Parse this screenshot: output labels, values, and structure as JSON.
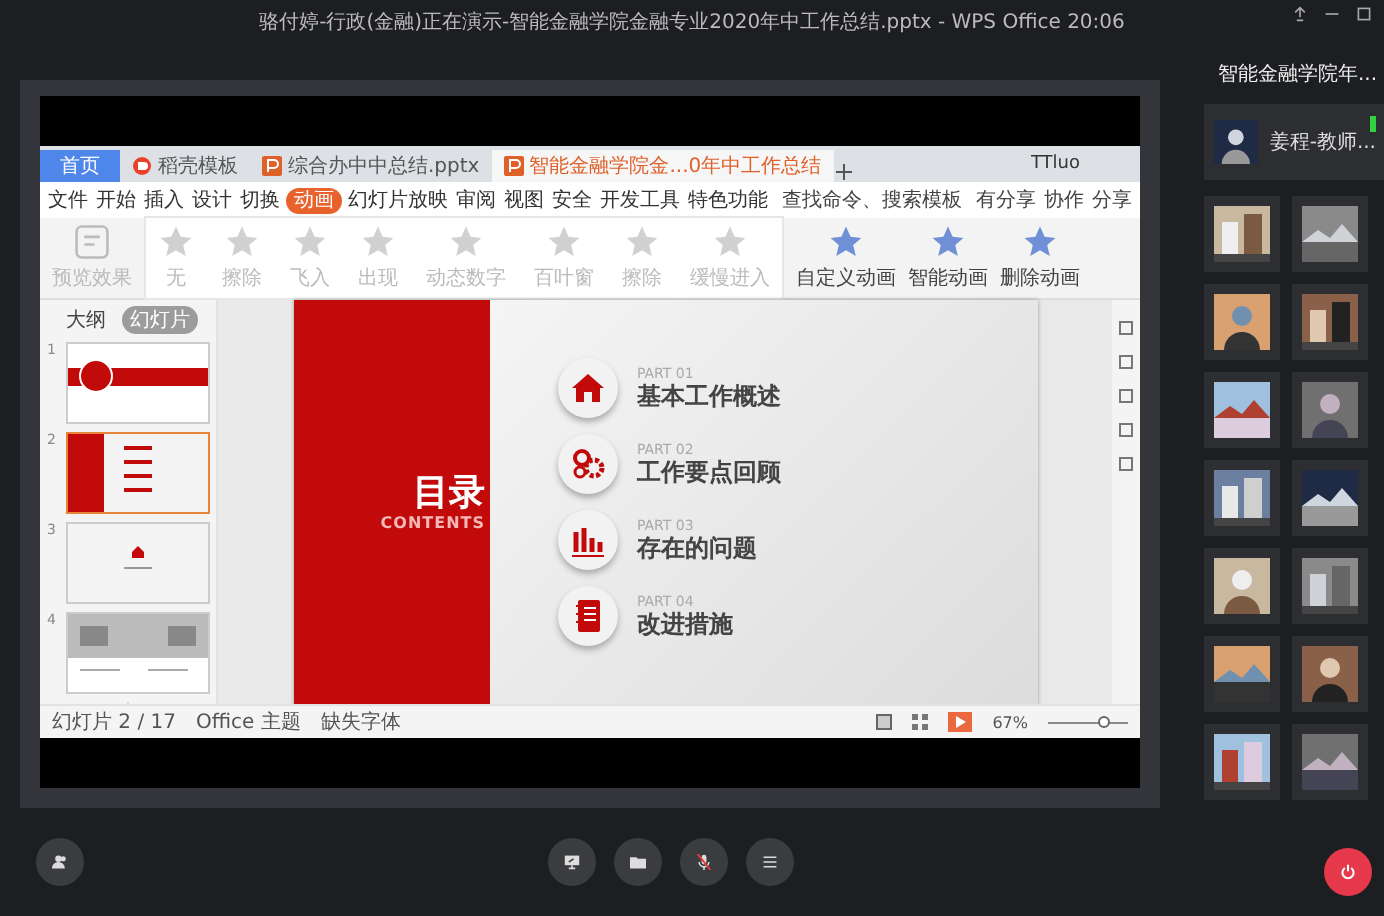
{
  "window": {
    "title": "骆付婷-行政(金融)正在演示-智能金融学院金融专业2020年中工作总结.pptx - WPS Office 20:06"
  },
  "meeting_panel": {
    "title": "智能金融学院年...",
    "host": {
      "name": "姜程-教师..."
    }
  },
  "presentation": {
    "tabs": [
      {
        "label": "首页",
        "kind": "home",
        "selected": false
      },
      {
        "label": "稻壳模板",
        "kind": "store",
        "selected": false
      },
      {
        "label": "综合办中中总结.pptx",
        "kind": "file",
        "selected": false
      },
      {
        "label": "智能金融学院金...0年中工作总结",
        "kind": "file",
        "selected": true
      }
    ],
    "user": "TTluo",
    "menu": [
      {
        "label": "文件",
        "selected": false
      },
      {
        "label": "开始",
        "selected": false
      },
      {
        "label": "插入",
        "selected": false
      },
      {
        "label": "设计",
        "selected": false
      },
      {
        "label": "切换",
        "selected": false
      },
      {
        "label": "动画",
        "selected": true
      },
      {
        "label": "幻灯片放映",
        "selected": false
      },
      {
        "label": "审阅",
        "selected": false
      },
      {
        "label": "视图",
        "selected": false
      },
      {
        "label": "安全",
        "selected": false
      },
      {
        "label": "开发工具",
        "selected": false
      },
      {
        "label": "特色功能",
        "selected": false
      }
    ],
    "search": "查找命令、搜索模板",
    "share_items": [
      "有分享",
      "协作",
      "分享"
    ],
    "ribbon": {
      "preview": "预览效果",
      "effects": [
        "无",
        "擦除",
        "飞入",
        "出现",
        "动态数字",
        "百叶窗",
        "擦除",
        "缓慢进入"
      ],
      "actions": [
        "自定义动画",
        "智能动画",
        "删除动画"
      ]
    },
    "panel_tabs": [
      {
        "label": "大纲",
        "selected": false
      },
      {
        "label": "幻灯片",
        "selected": true
      }
    ],
    "thumbnails": [
      {
        "number": "1",
        "kind": "cover",
        "selected": false
      },
      {
        "number": "2",
        "kind": "contents",
        "selected": true
      },
      {
        "number": "3",
        "kind": "section",
        "selected": false
      },
      {
        "number": "4",
        "selected": false
      }
    ],
    "slide": {
      "title": "目录",
      "subtitle": "CONTENTS",
      "items": [
        {
          "part": "PART 01",
          "heading": "基本工作概述",
          "kind": "house"
        },
        {
          "part": "PART 02",
          "heading": "工作要点回顾",
          "kind": "gears"
        },
        {
          "part": "PART 03",
          "heading": "存在的问题",
          "kind": "bars"
        },
        {
          "part": "PART 04",
          "heading": "改进措施",
          "kind": "notebook"
        }
      ]
    },
    "status": {
      "slide": "幻灯片 2 / 17",
      "theme": "Office 主题",
      "fonts": "缺失字体",
      "zoom": "67%",
      "zoom_slider": {
        "level": 0.7
      }
    }
  },
  "toolbar": [
    {
      "kind": "share-screen",
      "muted": false
    },
    {
      "kind": "folder",
      "muted": false
    },
    {
      "kind": "mic",
      "muted": true
    },
    {
      "kind": "menu",
      "muted": false
    }
  ]
}
